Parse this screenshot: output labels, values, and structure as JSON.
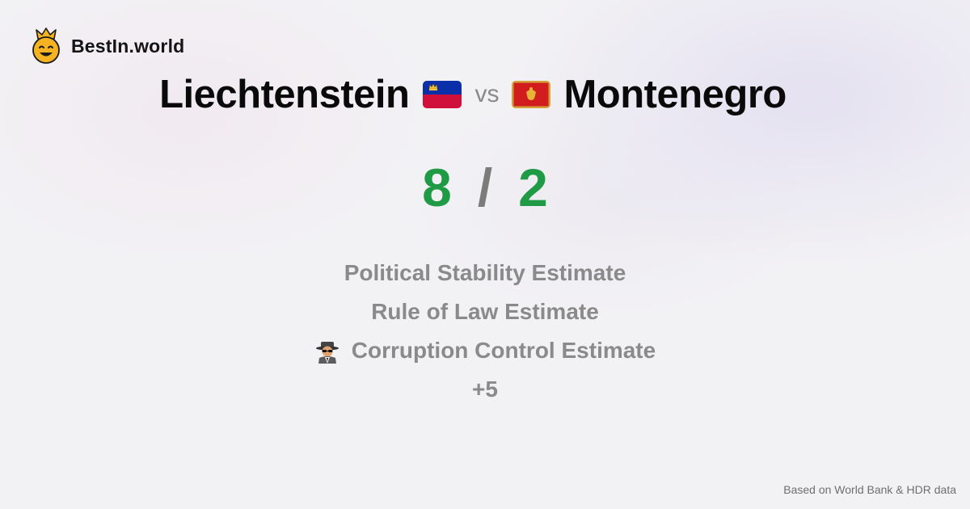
{
  "brand": {
    "name": "BestIn.world",
    "icon": "crowned-smiley-icon"
  },
  "comparison": {
    "left_country": "Liechtenstein",
    "left_flag": "liechtenstein-flag-icon",
    "vs_label": "vs",
    "right_country": "Montenegro",
    "right_flag": "montenegro-flag-icon"
  },
  "score": {
    "left": "8",
    "separator": "/",
    "right": "2"
  },
  "metrics": [
    {
      "label": "Political Stability Estimate"
    },
    {
      "label": "Rule of Law Estimate"
    },
    {
      "label": "Corruption Control Estimate",
      "icon": "spy-icon"
    },
    {
      "label": "+5"
    }
  ],
  "footer": {
    "source": "Based on World Bank & HDR data"
  },
  "colors": {
    "score": "#1f9a45",
    "muted": "#8a8a8a",
    "text": "#0a0a0a"
  }
}
